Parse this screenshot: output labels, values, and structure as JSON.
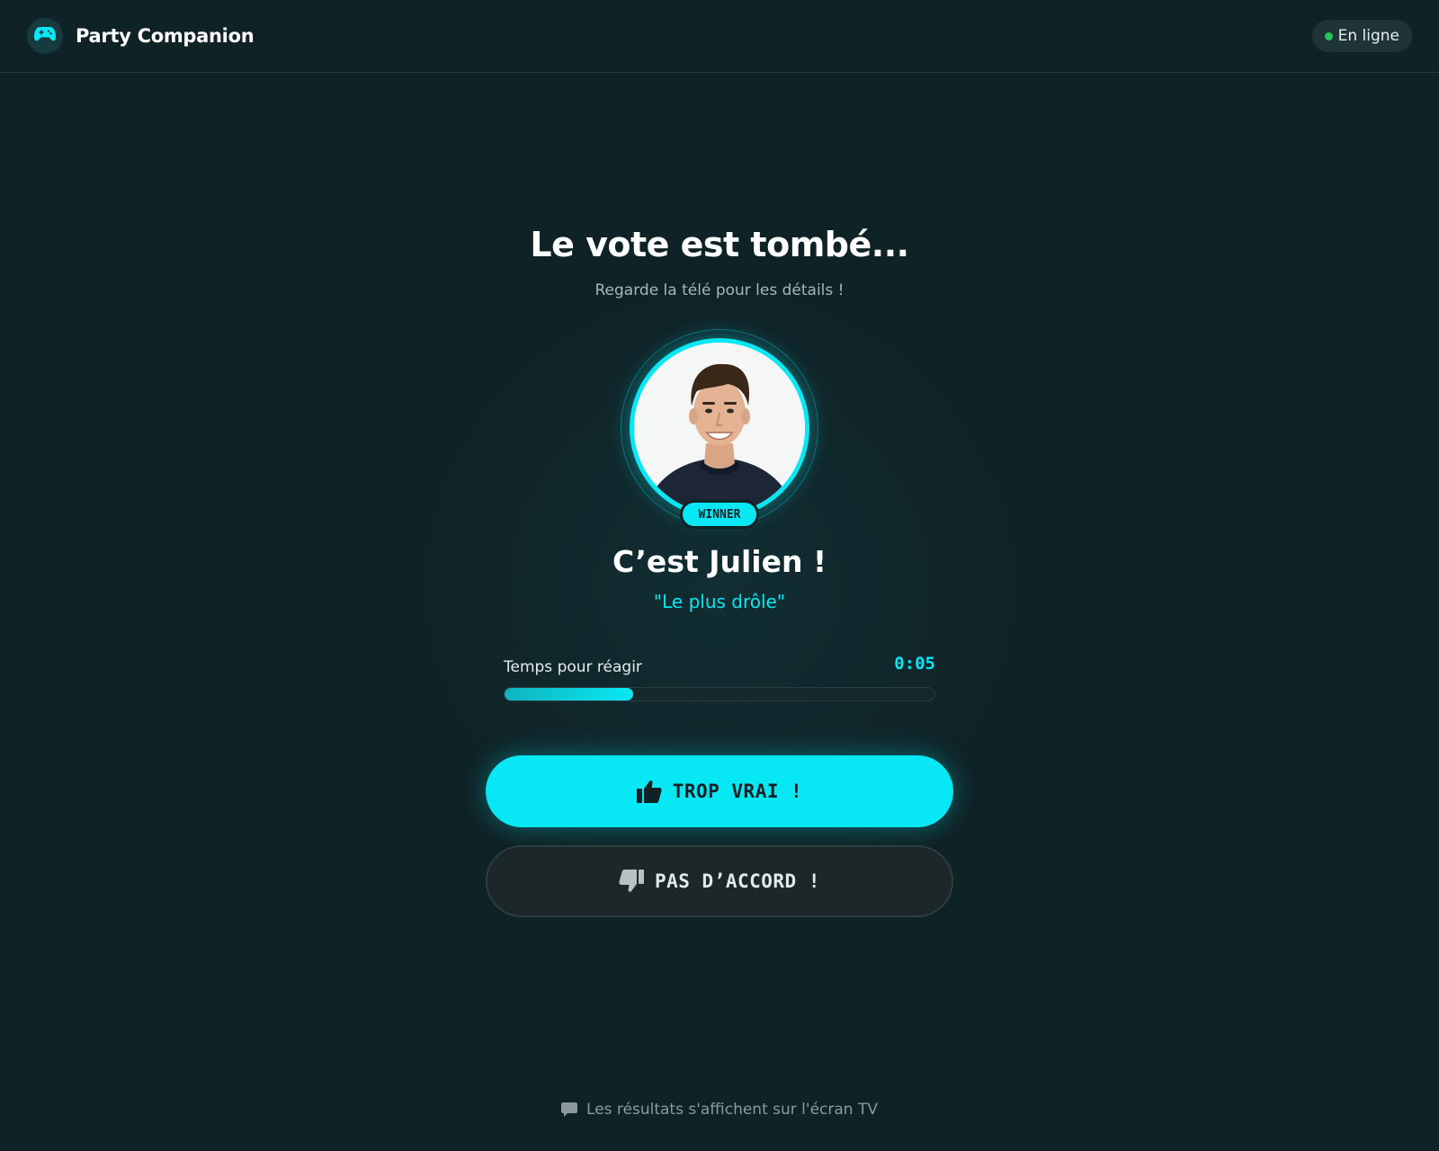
{
  "header": {
    "app_title": "Party Companion",
    "logo_icon": "gamepad-icon",
    "status_label": "En ligne",
    "status_color": "#22c55e"
  },
  "main": {
    "title": "Le vote est tombé...",
    "subtitle": "Regarde la télé pour les détails !",
    "winner_badge": "WINNER",
    "winner_name": "C’est Julien !",
    "category_quote": "\"Le plus drôle\"",
    "timer": {
      "label": "Temps pour réagir",
      "value": "0:05",
      "progress": 0.3
    }
  },
  "actions": {
    "agree_label": "TROP VRAI !",
    "agree_icon": "thumbs-up-icon",
    "disagree_label": "PAS D’ACCORD !",
    "disagree_icon": "thumbs-down-icon"
  },
  "footer": {
    "icon": "chat-icon",
    "text": "Les résultats s'affichent sur l'écran TV"
  },
  "colors": {
    "background": "#0f2226",
    "accent": "#08e8f4"
  }
}
